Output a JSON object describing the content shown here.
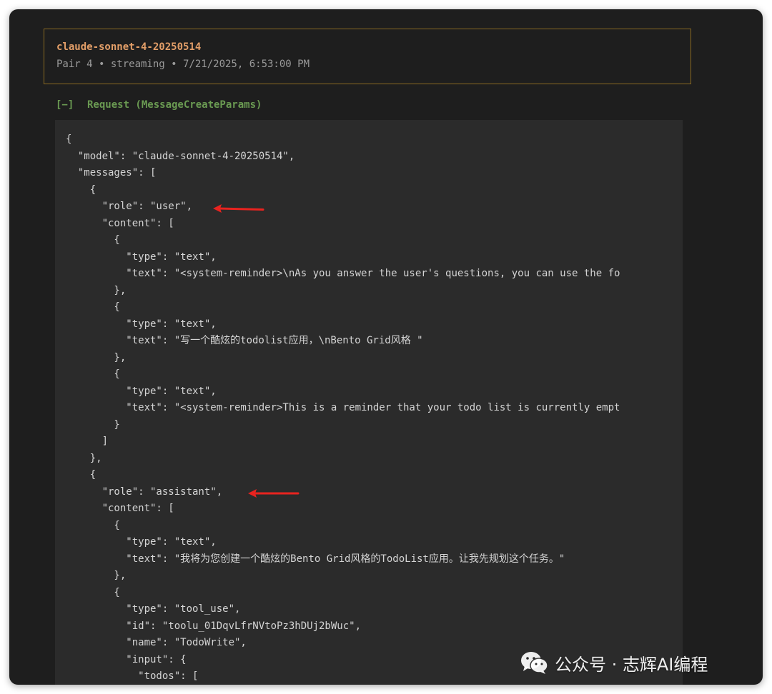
{
  "header": {
    "model": "claude-sonnet-4-20250514",
    "meta": "Pair 4 • streaming • 7/21/2025, 6:53:00 PM"
  },
  "section": {
    "toggle": "[−]",
    "title": "Request (MessageCreateParams)"
  },
  "code_lines": [
    "{",
    "  \"model\": \"claude-sonnet-4-20250514\",",
    "  \"messages\": [",
    "    {",
    "      \"role\": \"user\",",
    "      \"content\": [",
    "        {",
    "          \"type\": \"text\",",
    "          \"text\": \"<system-reminder>\\nAs you answer the user's questions, you can use the fo",
    "        },",
    "        {",
    "          \"type\": \"text\",",
    "          \"text\": \"写一个酷炫的todolist应用，\\nBento Grid风格 \"",
    "        },",
    "        {",
    "          \"type\": \"text\",",
    "          \"text\": \"<system-reminder>This is a reminder that your todo list is currently empt",
    "        }",
    "      ]",
    "    },",
    "    {",
    "      \"role\": \"assistant\",",
    "      \"content\": [",
    "        {",
    "          \"type\": \"text\",",
    "          \"text\": \"我将为您创建一个酷炫的Bento Grid风格的TodoList应用。让我先规划这个任务。\"",
    "        },",
    "        {",
    "          \"type\": \"tool_use\",",
    "          \"id\": \"toolu_01DqvLfrNVtoPz3hDUj2bWuc\",",
    "          \"name\": \"TodoWrite\",",
    "          \"input\": {",
    "            \"todos\": ["
  ],
  "watermark": {
    "text": "公众号 · 志辉AI编程",
    "icon": "wechat-icon"
  },
  "colors": {
    "window_bg": "#1e1e1e",
    "panel_bg": "#2b2b2b",
    "model_name": "#e29e68",
    "meta_text": "#9a9a9a",
    "section_title": "#6a9a52",
    "header_border": "#8a6a22",
    "arrow": "#e8231f"
  }
}
